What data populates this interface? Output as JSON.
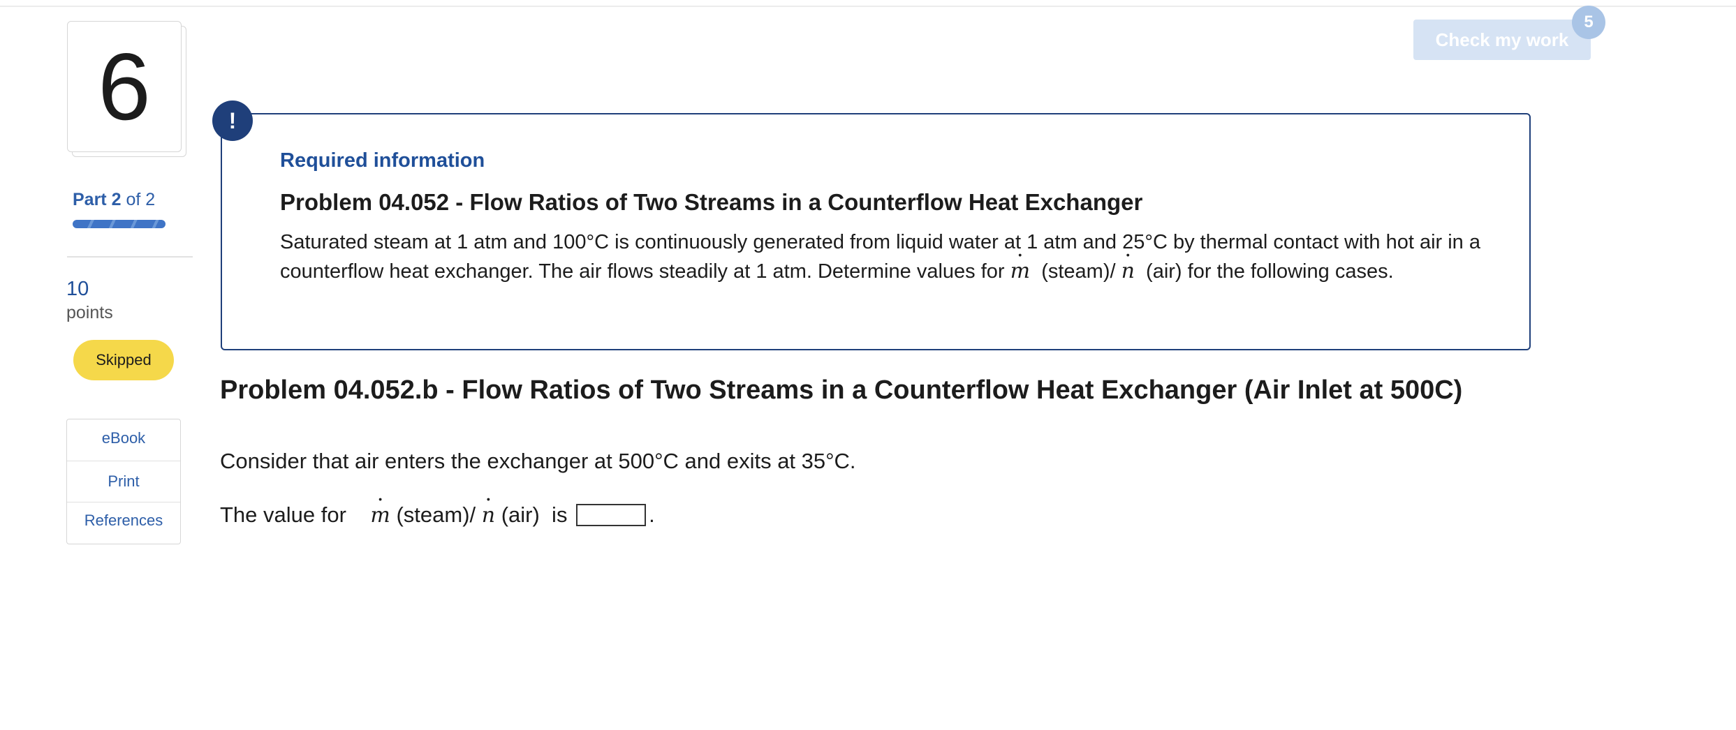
{
  "question": {
    "number": "6",
    "part_word": "Part",
    "part_current": "2",
    "part_of": "of 2",
    "part_progress": 1.0,
    "points_value": "10",
    "points_label": "points",
    "status": "Skipped"
  },
  "tools": {
    "ebook": "eBook",
    "print": "Print",
    "references": "References"
  },
  "header": {
    "check_label": "Check my work",
    "check_count": "5"
  },
  "required_info": {
    "alert_glyph": "!",
    "title": "Required information",
    "heading": "Problem 04.052 - Flow Ratios of Two Streams in a Counterflow Heat Exchanger",
    "body_part1": "Saturated steam at 1 atm and 100°C is continuously generated from liquid water at 1 atm and 25°C by thermal contact with hot air in a counterflow heat exchanger. The air flows steadily at 1 atm. Determine values for",
    "var_m": "m",
    "body_part2": "(steam)/",
    "var_n": "n",
    "body_part3": "(air) for the following cases."
  },
  "part_b": {
    "heading": "Problem 04.052.b - Flow Ratios of Two Streams in a Counterflow Heat Exchanger (Air Inlet at 500C)",
    "statement": "Consider that air enters the exchanger at 500°C and exits at 35°C.",
    "answer_prefix": "The value for",
    "var_m": "m",
    "answer_mid1": "(steam)/",
    "var_n": "n",
    "answer_mid2": "(air)  is",
    "answer_value": "",
    "answer_suffix": "."
  },
  "colors": {
    "accent_blue": "#1f3f7a",
    "link_blue": "#2d5ea8",
    "skipped_yellow": "#f5d84a",
    "check_disabled": "#d6e3f4"
  }
}
